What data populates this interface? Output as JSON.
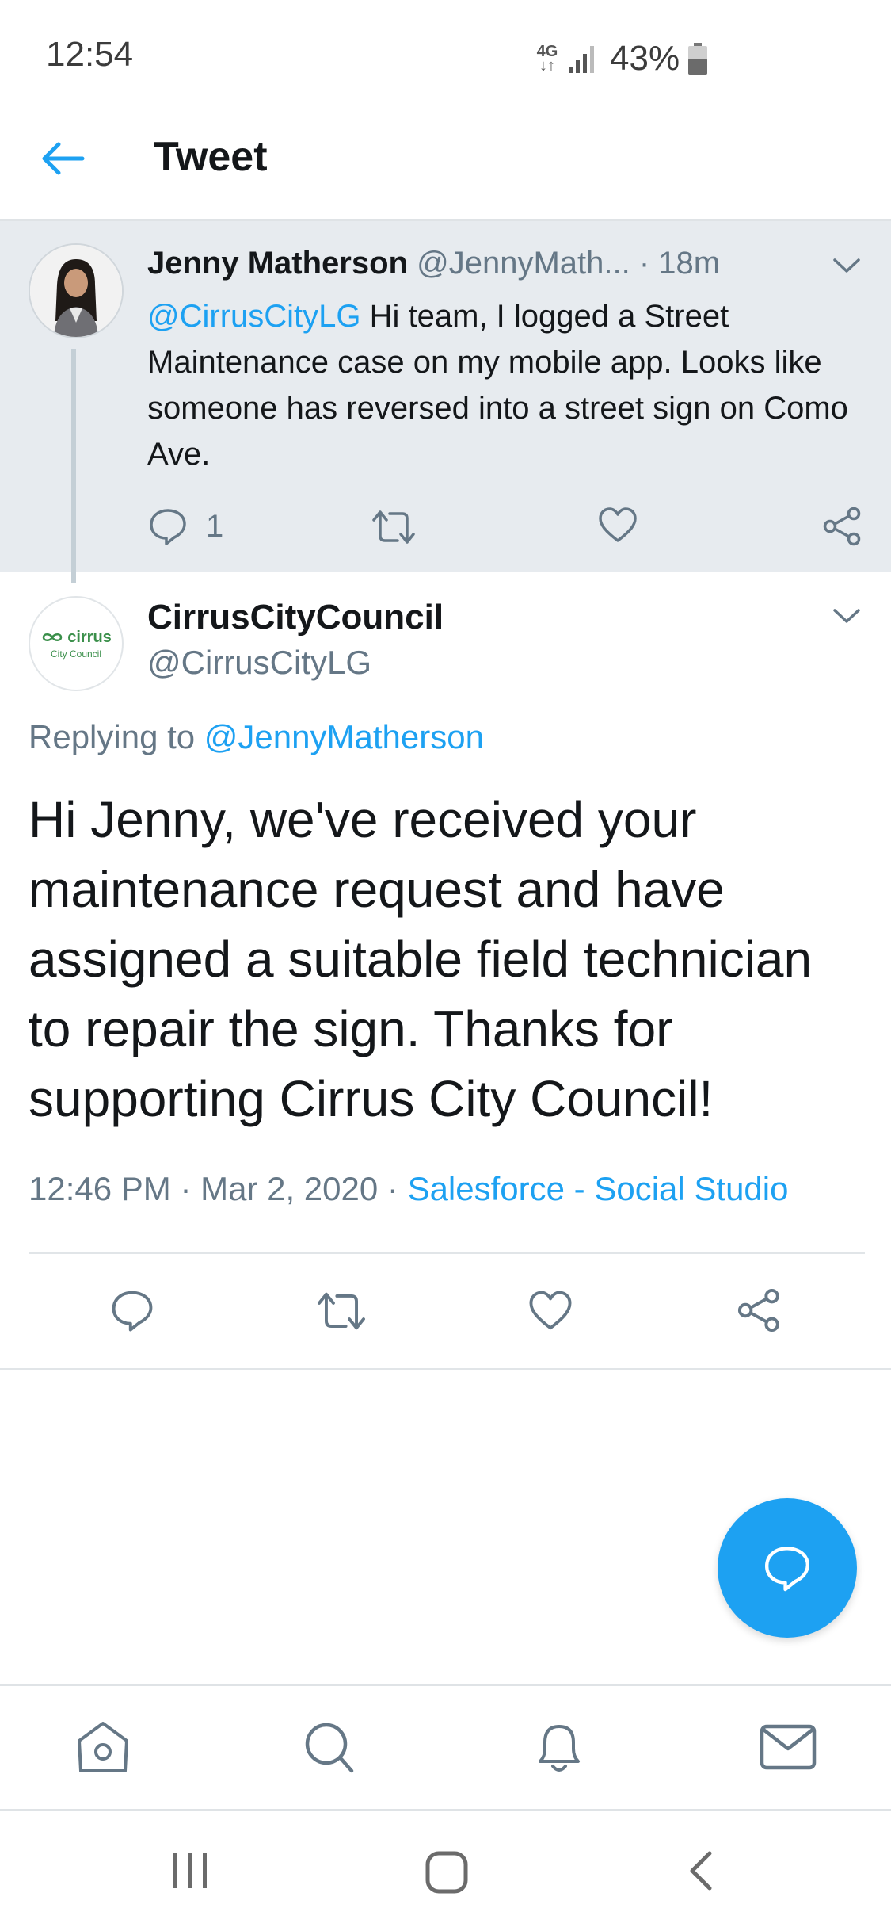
{
  "status_bar": {
    "time": "12:54",
    "network": "4G",
    "battery": "43%"
  },
  "header": {
    "title": "Tweet"
  },
  "parent_tweet": {
    "name": "Jenny Matherson",
    "handle": "@JennyMath...",
    "time": "· 18m",
    "mention": "@CirrusCityLG",
    "text": " Hi team, I logged a Street Maintenance case on my mobile app. Looks like someone has reversed into a street sign on Como Ave.",
    "reply_count": "1"
  },
  "reply_tweet": {
    "avatar_logo": "cirrus",
    "avatar_sub": "City Council",
    "name": "CirrusCityCouncil",
    "handle": "@CirrusCityLG",
    "replying_label": "Replying to ",
    "replying_to": "@JennyMatherson",
    "text": "Hi Jenny, we've received your maintenance request and have assigned a suitable field technician to repair the sign. Thanks for supporting Cirrus City Council!",
    "timestamp": "12:46 PM · Mar 2, 2020 · ",
    "source": "Salesforce - Social Studio"
  },
  "icons": {
    "back": "arrow-left-icon",
    "chevron": "chevron-down-icon",
    "reply": "reply-icon",
    "retweet": "retweet-icon",
    "like": "heart-icon",
    "share": "share-icon",
    "compose": "compose-reply-icon",
    "home": "home-icon",
    "search": "search-icon",
    "notifications": "bell-icon",
    "messages": "mail-icon"
  },
  "colors": {
    "accent": "#1da1f2",
    "muted": "#657786",
    "parent_bg": "#e7ebef"
  }
}
